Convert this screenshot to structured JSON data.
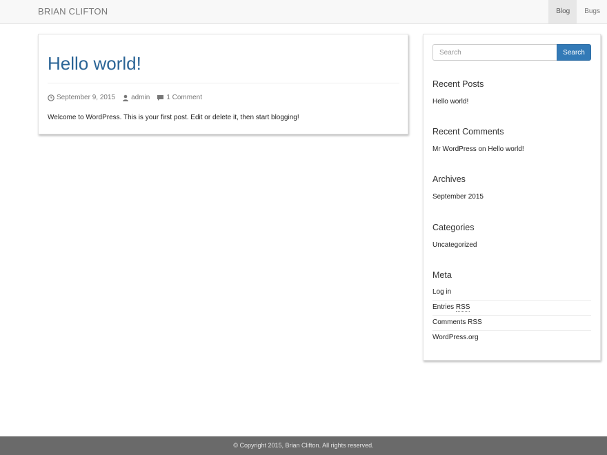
{
  "navbar": {
    "brand": "BRIAN CLIFTON",
    "items": [
      {
        "label": "Blog",
        "active": true
      },
      {
        "label": "Bugs",
        "active": false
      }
    ]
  },
  "post": {
    "title": "Hello world!",
    "date": "September 9, 2015",
    "author": "admin",
    "comments": "1 Comment",
    "body": "Welcome to WordPress. This is your first post. Edit or delete it, then start blogging!"
  },
  "sidebar": {
    "search": {
      "placeholder": "Search",
      "button": "Search"
    },
    "recent_posts": {
      "title": "Recent Posts",
      "items": [
        "Hello world!"
      ]
    },
    "recent_comments": {
      "title": "Recent Comments",
      "items": [
        {
          "author": "Mr WordPress",
          "on": "on",
          "post": "Hello world!"
        }
      ]
    },
    "archives": {
      "title": "Archives",
      "items": [
        "September 2015"
      ]
    },
    "categories": {
      "title": "Categories",
      "items": [
        "Uncategorized"
      ]
    },
    "meta": {
      "title": "Meta",
      "items": [
        "Log in",
        "Entries",
        "RSS",
        "Comments RSS",
        "WordPress.org"
      ]
    }
  },
  "footer": {
    "text": "© Copyright 2015, Brian Clifton. All rights reserved."
  },
  "colors": {
    "accent": "#337ab7",
    "title_link": "#2a6496",
    "navbar_bg": "#f8f8f8",
    "footer_bg": "#6a6a6a"
  }
}
